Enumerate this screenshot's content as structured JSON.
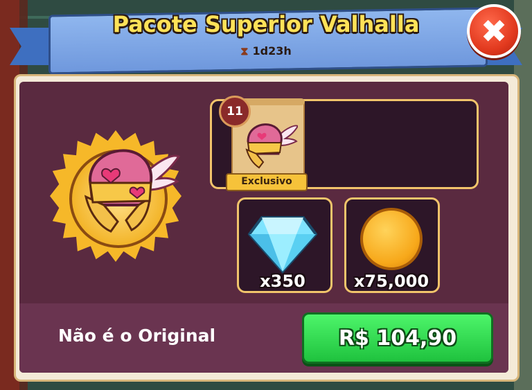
{
  "header": {
    "title": "Pacote Superior Valhalla",
    "timer": "1d23h"
  },
  "featured_item": {
    "level": "11",
    "tag": "Exclusivo",
    "icon": "valkyrie-helmet-icon"
  },
  "rewards": [
    {
      "icon": "diamond-icon",
      "amount": "x350"
    },
    {
      "icon": "gold-coin-icon",
      "amount": "x75,000"
    }
  ],
  "footer": {
    "note": "Não é o Original",
    "price": "R$ 104,90"
  },
  "colors": {
    "title_yellow": "#ffe258",
    "banner_blue": "#6f98dd",
    "panel_purple": "#5a2a40",
    "buy_green": "#1fc23e",
    "close_red": "#e23a1f"
  }
}
